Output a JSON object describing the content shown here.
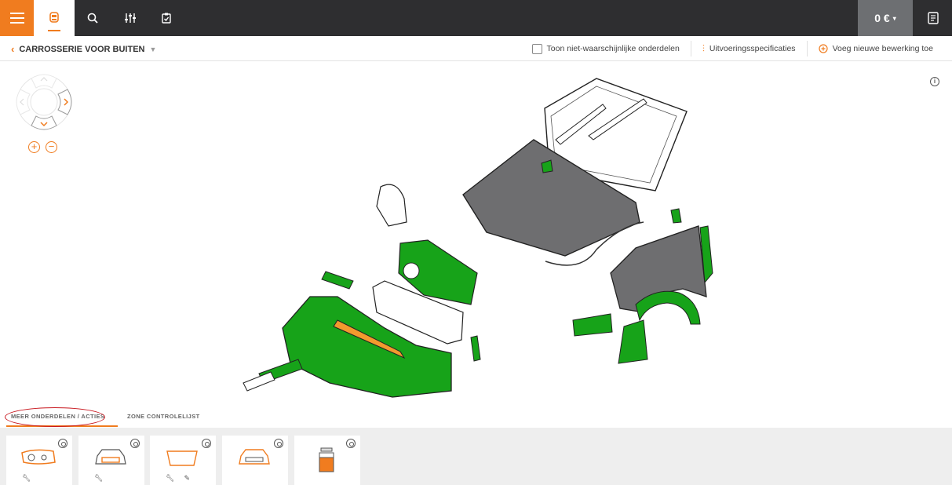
{
  "topbar": {
    "price": "0 €",
    "icons": [
      "menu-icon",
      "car-icon",
      "search-icon",
      "filter-icon",
      "checklist-icon",
      "document-icon"
    ],
    "accent": "#f07c1f",
    "dark": "#2e2e30"
  },
  "breadcrumb": {
    "label": "CARROSSERIE VOOR BUITEN"
  },
  "actions": {
    "show_unlikely": "Toon niet-waarschijnlijke onderdelen",
    "specs": "Uitvoeringsspecificaties",
    "add_work": "Voeg nieuwe bewerking toe"
  },
  "tabs": {
    "more_parts": "MEER ONDERDELEN / ACTIES",
    "zone_checklist": "ZONE CONTROLELIJST"
  },
  "colors": {
    "part_green": "#17a319",
    "part_orange": "#f29a2e",
    "panel_grey": "#6e6e70",
    "annotation_red": "#c8161d"
  },
  "tray_cards": [
    {
      "name": "headlight-card"
    },
    {
      "name": "car-front-card"
    },
    {
      "name": "windshield-card"
    },
    {
      "name": "car-rear-card"
    },
    {
      "name": "fluid-card"
    }
  ]
}
